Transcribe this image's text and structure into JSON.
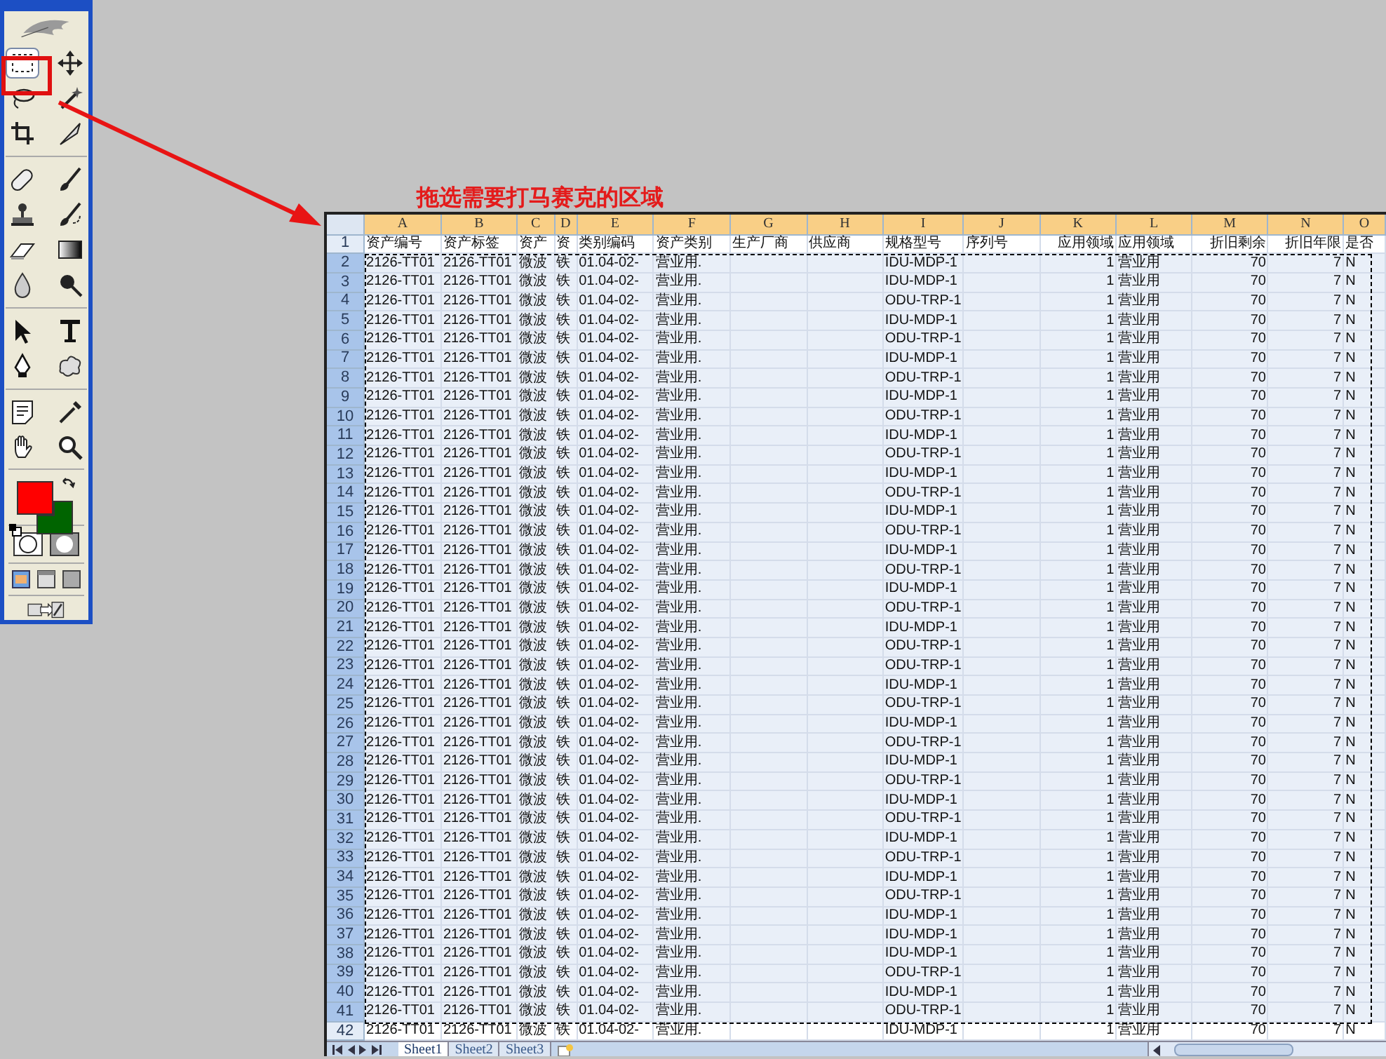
{
  "toolbox": {
    "tools": [
      {
        "kind": "marquee",
        "selected": true
      },
      {
        "kind": "move",
        "selected": false
      },
      {
        "kind": "lasso",
        "selected": false
      },
      {
        "kind": "wand",
        "selected": false
      },
      {
        "kind": "crop",
        "selected": false
      },
      {
        "kind": "slice",
        "selected": false
      },
      {
        "kind": "healing",
        "selected": false
      },
      {
        "kind": "brush",
        "selected": false
      },
      {
        "kind": "stamp",
        "selected": false
      },
      {
        "kind": "history",
        "selected": false
      },
      {
        "kind": "eraser",
        "selected": false
      },
      {
        "kind": "gradient",
        "selected": false
      },
      {
        "kind": "blur",
        "selected": false
      },
      {
        "kind": "dodge",
        "selected": false
      },
      {
        "kind": "select",
        "selected": false
      },
      {
        "kind": "type",
        "selected": false
      },
      {
        "kind": "pen",
        "selected": false
      },
      {
        "kind": "shape",
        "selected": false
      },
      {
        "kind": "notes",
        "selected": false
      },
      {
        "kind": "eyedropper",
        "selected": false
      },
      {
        "kind": "hand",
        "selected": false
      },
      {
        "kind": "zoom",
        "selected": false
      }
    ]
  },
  "annotation": {
    "text": "拖选需要打马赛克的区域"
  },
  "spreadsheet": {
    "columns": [
      {
        "letter": "A",
        "selected": true
      },
      {
        "letter": "B",
        "selected": true
      },
      {
        "letter": "C",
        "selected": true
      },
      {
        "letter": "D",
        "selected": true
      },
      {
        "letter": "E",
        "selected": true
      },
      {
        "letter": "F",
        "selected": true
      },
      {
        "letter": "G",
        "selected": true
      },
      {
        "letter": "H",
        "selected": true
      },
      {
        "letter": "I",
        "selected": true
      },
      {
        "letter": "J",
        "selected": true
      },
      {
        "letter": "K",
        "selected": true
      },
      {
        "letter": "L",
        "selected": true
      },
      {
        "letter": "M",
        "selected": true
      },
      {
        "letter": "N",
        "selected": true
      },
      {
        "letter": "O",
        "selected": true
      }
    ],
    "rows": [
      {
        "number": "1",
        "selected": false,
        "cells": {
          "A": "资产编号",
          "B": "资产标签",
          "C": "资产",
          "D": "资",
          "E": "类别编码",
          "F": "资产类别",
          "G": "生产厂商",
          "H": "供应商",
          "I": "规格型号",
          "J": "序列号",
          "K": "应用领域",
          "L": "应用领域",
          "M": "折旧剩余",
          "N": "折旧年限",
          "O": "是否"
        }
      },
      {
        "number": "2",
        "selected": true,
        "cells": {
          "A": "2126-TT01",
          "B": "2126-TT01",
          "C": "微波",
          "D": "铁",
          "E": "01.04-02-",
          "F": "营业用.",
          "I": "IDU-MDP-1",
          "K": "1",
          "L": "营业用",
          "M": "70",
          "N": "7",
          "O": "N"
        }
      },
      {
        "number": "3",
        "selected": true,
        "cells": {
          "A": "2126-TT01",
          "B": "2126-TT01",
          "C": "微波",
          "D": "铁",
          "E": "01.04-02-",
          "F": "营业用.",
          "I": "IDU-MDP-1",
          "K": "1",
          "L": "营业用",
          "M": "70",
          "N": "7",
          "O": "N"
        }
      },
      {
        "number": "4",
        "selected": true,
        "cells": {
          "A": "2126-TT01",
          "B": "2126-TT01",
          "C": "微波",
          "D": "铁",
          "E": "01.04-02-",
          "F": "营业用.",
          "I": "ODU-TRP-1",
          "K": "1",
          "L": "营业用",
          "M": "70",
          "N": "7",
          "O": "N"
        }
      },
      {
        "number": "5",
        "selected": true,
        "cells": {
          "A": "2126-TT01",
          "B": "2126-TT01",
          "C": "微波",
          "D": "铁",
          "E": "01.04-02-",
          "F": "营业用.",
          "I": "IDU-MDP-1",
          "K": "1",
          "L": "营业用",
          "M": "70",
          "N": "7",
          "O": "N"
        }
      },
      {
        "number": "6",
        "selected": true,
        "cells": {
          "A": "2126-TT01",
          "B": "2126-TT01",
          "C": "微波",
          "D": "铁",
          "E": "01.04-02-",
          "F": "营业用.",
          "I": "ODU-TRP-1",
          "K": "1",
          "L": "营业用",
          "M": "70",
          "N": "7",
          "O": "N"
        }
      },
      {
        "number": "7",
        "selected": true,
        "cells": {
          "A": "2126-TT01",
          "B": "2126-TT01",
          "C": "微波",
          "D": "铁",
          "E": "01.04-02-",
          "F": "营业用.",
          "I": "IDU-MDP-1",
          "K": "1",
          "L": "营业用",
          "M": "70",
          "N": "7",
          "O": "N"
        }
      },
      {
        "number": "8",
        "selected": true,
        "cells": {
          "A": "2126-TT01",
          "B": "2126-TT01",
          "C": "微波",
          "D": "铁",
          "E": "01.04-02-",
          "F": "营业用.",
          "I": "ODU-TRP-1",
          "K": "1",
          "L": "营业用",
          "M": "70",
          "N": "7",
          "O": "N"
        }
      },
      {
        "number": "9",
        "selected": true,
        "cells": {
          "A": "2126-TT01",
          "B": "2126-TT01",
          "C": "微波",
          "D": "铁",
          "E": "01.04-02-",
          "F": "营业用.",
          "I": "IDU-MDP-1",
          "K": "1",
          "L": "营业用",
          "M": "70",
          "N": "7",
          "O": "N"
        }
      },
      {
        "number": "10",
        "selected": true,
        "cells": {
          "A": "2126-TT01",
          "B": "2126-TT01",
          "C": "微波",
          "D": "铁",
          "E": "01.04-02-",
          "F": "营业用.",
          "I": "ODU-TRP-1",
          "K": "1",
          "L": "营业用",
          "M": "70",
          "N": "7",
          "O": "N"
        }
      },
      {
        "number": "11",
        "selected": true,
        "cells": {
          "A": "2126-TT01",
          "B": "2126-TT01",
          "C": "微波",
          "D": "铁",
          "E": "01.04-02-",
          "F": "营业用.",
          "I": "IDU-MDP-1",
          "K": "1",
          "L": "营业用",
          "M": "70",
          "N": "7",
          "O": "N"
        }
      },
      {
        "number": "12",
        "selected": true,
        "cells": {
          "A": "2126-TT01",
          "B": "2126-TT01",
          "C": "微波",
          "D": "铁",
          "E": "01.04-02-",
          "F": "营业用.",
          "I": "ODU-TRP-1",
          "K": "1",
          "L": "营业用",
          "M": "70",
          "N": "7",
          "O": "N"
        }
      },
      {
        "number": "13",
        "selected": true,
        "cells": {
          "A": "2126-TT01",
          "B": "2126-TT01",
          "C": "微波",
          "D": "铁",
          "E": "01.04-02-",
          "F": "营业用.",
          "I": "IDU-MDP-1",
          "K": "1",
          "L": "营业用",
          "M": "70",
          "N": "7",
          "O": "N"
        }
      },
      {
        "number": "14",
        "selected": true,
        "cells": {
          "A": "2126-TT01",
          "B": "2126-TT01",
          "C": "微波",
          "D": "铁",
          "E": "01.04-02-",
          "F": "营业用.",
          "I": "ODU-TRP-1",
          "K": "1",
          "L": "营业用",
          "M": "70",
          "N": "7",
          "O": "N"
        }
      },
      {
        "number": "15",
        "selected": true,
        "cells": {
          "A": "2126-TT01",
          "B": "2126-TT01",
          "C": "微波",
          "D": "铁",
          "E": "01.04-02-",
          "F": "营业用.",
          "I": "IDU-MDP-1",
          "K": "1",
          "L": "营业用",
          "M": "70",
          "N": "7",
          "O": "N"
        }
      },
      {
        "number": "16",
        "selected": true,
        "cells": {
          "A": "2126-TT01",
          "B": "2126-TT01",
          "C": "微波",
          "D": "铁",
          "E": "01.04-02-",
          "F": "营业用.",
          "I": "ODU-TRP-1",
          "K": "1",
          "L": "营业用",
          "M": "70",
          "N": "7",
          "O": "N"
        }
      },
      {
        "number": "17",
        "selected": true,
        "cells": {
          "A": "2126-TT01",
          "B": "2126-TT01",
          "C": "微波",
          "D": "铁",
          "E": "01.04-02-",
          "F": "营业用.",
          "I": "IDU-MDP-1",
          "K": "1",
          "L": "营业用",
          "M": "70",
          "N": "7",
          "O": "N"
        }
      },
      {
        "number": "18",
        "selected": true,
        "cells": {
          "A": "2126-TT01",
          "B": "2126-TT01",
          "C": "微波",
          "D": "铁",
          "E": "01.04-02-",
          "F": "营业用.",
          "I": "ODU-TRP-1",
          "K": "1",
          "L": "营业用",
          "M": "70",
          "N": "7",
          "O": "N"
        }
      },
      {
        "number": "19",
        "selected": true,
        "cells": {
          "A": "2126-TT01",
          "B": "2126-TT01",
          "C": "微波",
          "D": "铁",
          "E": "01.04-02-",
          "F": "营业用.",
          "I": "IDU-MDP-1",
          "K": "1",
          "L": "营业用",
          "M": "70",
          "N": "7",
          "O": "N"
        }
      },
      {
        "number": "20",
        "selected": true,
        "cells": {
          "A": "2126-TT01",
          "B": "2126-TT01",
          "C": "微波",
          "D": "铁",
          "E": "01.04-02-",
          "F": "营业用.",
          "I": "ODU-TRP-1",
          "K": "1",
          "L": "营业用",
          "M": "70",
          "N": "7",
          "O": "N"
        }
      },
      {
        "number": "21",
        "selected": true,
        "cells": {
          "A": "2126-TT01",
          "B": "2126-TT01",
          "C": "微波",
          "D": "铁",
          "E": "01.04-02-",
          "F": "营业用.",
          "I": "IDU-MDP-1",
          "K": "1",
          "L": "营业用",
          "M": "70",
          "N": "7",
          "O": "N"
        }
      },
      {
        "number": "22",
        "selected": true,
        "cells": {
          "A": "2126-TT01",
          "B": "2126-TT01",
          "C": "微波",
          "D": "铁",
          "E": "01.04-02-",
          "F": "营业用.",
          "I": "ODU-TRP-1",
          "K": "1",
          "L": "营业用",
          "M": "70",
          "N": "7",
          "O": "N"
        }
      },
      {
        "number": "23",
        "selected": true,
        "cells": {
          "A": "2126-TT01",
          "B": "2126-TT01",
          "C": "微波",
          "D": "铁",
          "E": "01.04-02-",
          "F": "营业用.",
          "I": "ODU-TRP-1",
          "K": "1",
          "L": "营业用",
          "M": "70",
          "N": "7",
          "O": "N"
        }
      },
      {
        "number": "24",
        "selected": true,
        "cells": {
          "A": "2126-TT01",
          "B": "2126-TT01",
          "C": "微波",
          "D": "铁",
          "E": "01.04-02-",
          "F": "营业用.",
          "I": "IDU-MDP-1",
          "K": "1",
          "L": "营业用",
          "M": "70",
          "N": "7",
          "O": "N"
        }
      },
      {
        "number": "25",
        "selected": true,
        "cells": {
          "A": "2126-TT01",
          "B": "2126-TT01",
          "C": "微波",
          "D": "铁",
          "E": "01.04-02-",
          "F": "营业用.",
          "I": "ODU-TRP-1",
          "K": "1",
          "L": "营业用",
          "M": "70",
          "N": "7",
          "O": "N"
        }
      },
      {
        "number": "26",
        "selected": true,
        "cells": {
          "A": "2126-TT01",
          "B": "2126-TT01",
          "C": "微波",
          "D": "铁",
          "E": "01.04-02-",
          "F": "营业用.",
          "I": "IDU-MDP-1",
          "K": "1",
          "L": "营业用",
          "M": "70",
          "N": "7",
          "O": "N"
        }
      },
      {
        "number": "27",
        "selected": true,
        "cells": {
          "A": "2126-TT01",
          "B": "2126-TT01",
          "C": "微波",
          "D": "铁",
          "E": "01.04-02-",
          "F": "营业用.",
          "I": "ODU-TRP-1",
          "K": "1",
          "L": "营业用",
          "M": "70",
          "N": "7",
          "O": "N"
        }
      },
      {
        "number": "28",
        "selected": true,
        "cells": {
          "A": "2126-TT01",
          "B": "2126-TT01",
          "C": "微波",
          "D": "铁",
          "E": "01.04-02-",
          "F": "营业用.",
          "I": "IDU-MDP-1",
          "K": "1",
          "L": "营业用",
          "M": "70",
          "N": "7",
          "O": "N"
        }
      },
      {
        "number": "29",
        "selected": true,
        "cells": {
          "A": "2126-TT01",
          "B": "2126-TT01",
          "C": "微波",
          "D": "铁",
          "E": "01.04-02-",
          "F": "营业用.",
          "I": "ODU-TRP-1",
          "K": "1",
          "L": "营业用",
          "M": "70",
          "N": "7",
          "O": "N"
        }
      },
      {
        "number": "30",
        "selected": true,
        "cells": {
          "A": "2126-TT01",
          "B": "2126-TT01",
          "C": "微波",
          "D": "铁",
          "E": "01.04-02-",
          "F": "营业用.",
          "I": "IDU-MDP-1",
          "K": "1",
          "L": "营业用",
          "M": "70",
          "N": "7",
          "O": "N"
        }
      },
      {
        "number": "31",
        "selected": true,
        "cells": {
          "A": "2126-TT01",
          "B": "2126-TT01",
          "C": "微波",
          "D": "铁",
          "E": "01.04-02-",
          "F": "营业用.",
          "I": "ODU-TRP-1",
          "K": "1",
          "L": "营业用",
          "M": "70",
          "N": "7",
          "O": "N"
        }
      },
      {
        "number": "32",
        "selected": true,
        "cells": {
          "A": "2126-TT01",
          "B": "2126-TT01",
          "C": "微波",
          "D": "铁",
          "E": "01.04-02-",
          "F": "营业用.",
          "I": "IDU-MDP-1",
          "K": "1",
          "L": "营业用",
          "M": "70",
          "N": "7",
          "O": "N"
        }
      },
      {
        "number": "33",
        "selected": true,
        "cells": {
          "A": "2126-TT01",
          "B": "2126-TT01",
          "C": "微波",
          "D": "铁",
          "E": "01.04-02-",
          "F": "营业用.",
          "I": "ODU-TRP-1",
          "K": "1",
          "L": "营业用",
          "M": "70",
          "N": "7",
          "O": "N"
        }
      },
      {
        "number": "34",
        "selected": true,
        "cells": {
          "A": "2126-TT01",
          "B": "2126-TT01",
          "C": "微波",
          "D": "铁",
          "E": "01.04-02-",
          "F": "营业用.",
          "I": "IDU-MDP-1",
          "K": "1",
          "L": "营业用",
          "M": "70",
          "N": "7",
          "O": "N"
        }
      },
      {
        "number": "35",
        "selected": true,
        "cells": {
          "A": "2126-TT01",
          "B": "2126-TT01",
          "C": "微波",
          "D": "铁",
          "E": "01.04-02-",
          "F": "营业用.",
          "I": "ODU-TRP-1",
          "K": "1",
          "L": "营业用",
          "M": "70",
          "N": "7",
          "O": "N"
        }
      },
      {
        "number": "36",
        "selected": true,
        "cells": {
          "A": "2126-TT01",
          "B": "2126-TT01",
          "C": "微波",
          "D": "铁",
          "E": "01.04-02-",
          "F": "营业用.",
          "I": "IDU-MDP-1",
          "K": "1",
          "L": "营业用",
          "M": "70",
          "N": "7",
          "O": "N"
        }
      },
      {
        "number": "37",
        "selected": true,
        "cells": {
          "A": "2126-TT01",
          "B": "2126-TT01",
          "C": "微波",
          "D": "铁",
          "E": "01.04-02-",
          "F": "营业用.",
          "I": "IDU-MDP-1",
          "K": "1",
          "L": "营业用",
          "M": "70",
          "N": "7",
          "O": "N"
        }
      },
      {
        "number": "38",
        "selected": true,
        "cells": {
          "A": "2126-TT01",
          "B": "2126-TT01",
          "C": "微波",
          "D": "铁",
          "E": "01.04-02-",
          "F": "营业用.",
          "I": "IDU-MDP-1",
          "K": "1",
          "L": "营业用",
          "M": "70",
          "N": "7",
          "O": "N"
        }
      },
      {
        "number": "39",
        "selected": true,
        "cells": {
          "A": "2126-TT01",
          "B": "2126-TT01",
          "C": "微波",
          "D": "铁",
          "E": "01.04-02-",
          "F": "营业用.",
          "I": "ODU-TRP-1",
          "K": "1",
          "L": "营业用",
          "M": "70",
          "N": "7",
          "O": "N"
        }
      },
      {
        "number": "40",
        "selected": true,
        "cells": {
          "A": "2126-TT01",
          "B": "2126-TT01",
          "C": "微波",
          "D": "铁",
          "E": "01.04-02-",
          "F": "营业用.",
          "I": "IDU-MDP-1",
          "K": "1",
          "L": "营业用",
          "M": "70",
          "N": "7",
          "O": "N"
        }
      },
      {
        "number": "41",
        "selected": true,
        "cells": {
          "A": "2126-TT01",
          "B": "2126-TT01",
          "C": "微波",
          "D": "铁",
          "E": "01.04-02-",
          "F": "营业用.",
          "I": "ODU-TRP-1",
          "K": "1",
          "L": "营业用",
          "M": "70",
          "N": "7",
          "O": "N"
        }
      },
      {
        "number": "42",
        "selected": false,
        "cells": {
          "A": "2126-TT01",
          "B": "2126-TT01",
          "C": "微波",
          "D": "铁",
          "E": "01.04-02-",
          "F": "营业用.",
          "I": "IDU-MDP-1",
          "K": "1",
          "L": "营业用",
          "M": "70",
          "N": "7",
          "O": "N"
        }
      }
    ],
    "sheet_tabs": [
      {
        "label": "Sheet1",
        "selected": true
      },
      {
        "label": "Sheet2",
        "selected": false
      },
      {
        "label": "Sheet3",
        "selected": false
      }
    ]
  }
}
